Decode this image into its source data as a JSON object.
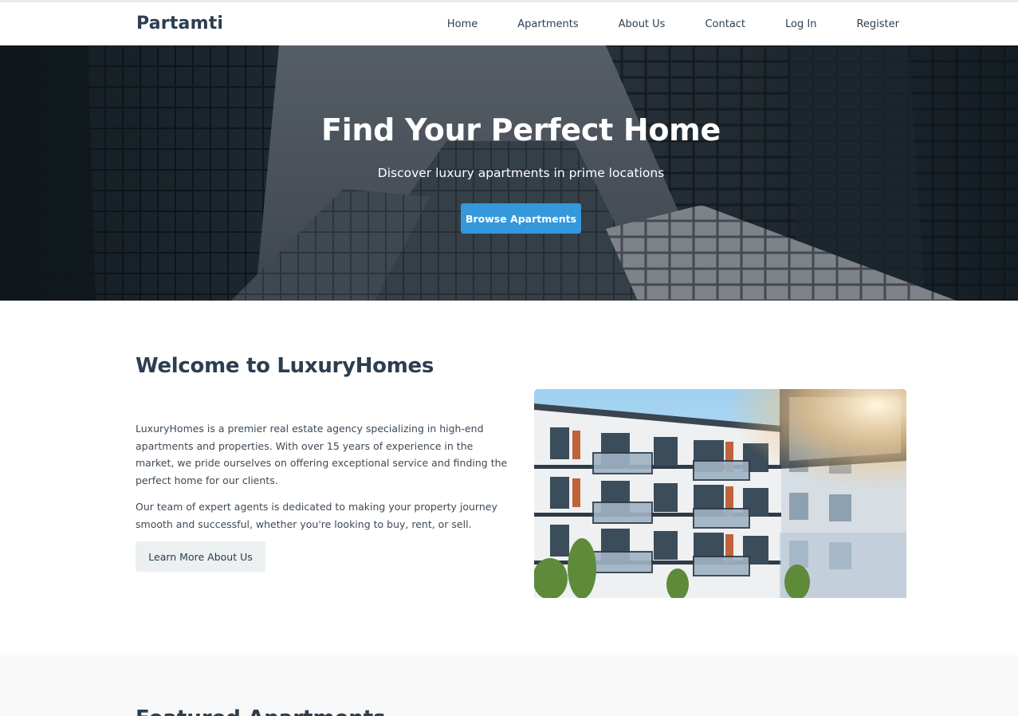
{
  "nav": {
    "brand": "Partamti",
    "links": [
      "Home",
      "Apartments",
      "About Us",
      "Contact",
      "Log In",
      "Register"
    ]
  },
  "hero": {
    "title": "Find Your Perfect Home",
    "subtitle": "Discover luxury apartments in prime locations",
    "button_label": "Browse Apartments"
  },
  "welcome": {
    "title": "Welcome to LuxuryHomes",
    "paragraph1": "LuxuryHomes is a premier real estate agency specializing in high-end apartments and properties. With over 15 years of experience in the market, we pride ourselves on offering exceptional service and finding the perfect home for our clients.",
    "paragraph2": "Our team of expert agents is dedicated to making your property journey smooth and successful, whether you're looking to buy, rent, or sell.",
    "button_label": "Learn More About Us"
  },
  "featured": {
    "title": "Featured Apartments"
  },
  "colors": {
    "primary": "#3498db",
    "text_dark": "#2c3e50",
    "button_light": "#ecf0f1",
    "section_bg": "#f8f8f8"
  }
}
